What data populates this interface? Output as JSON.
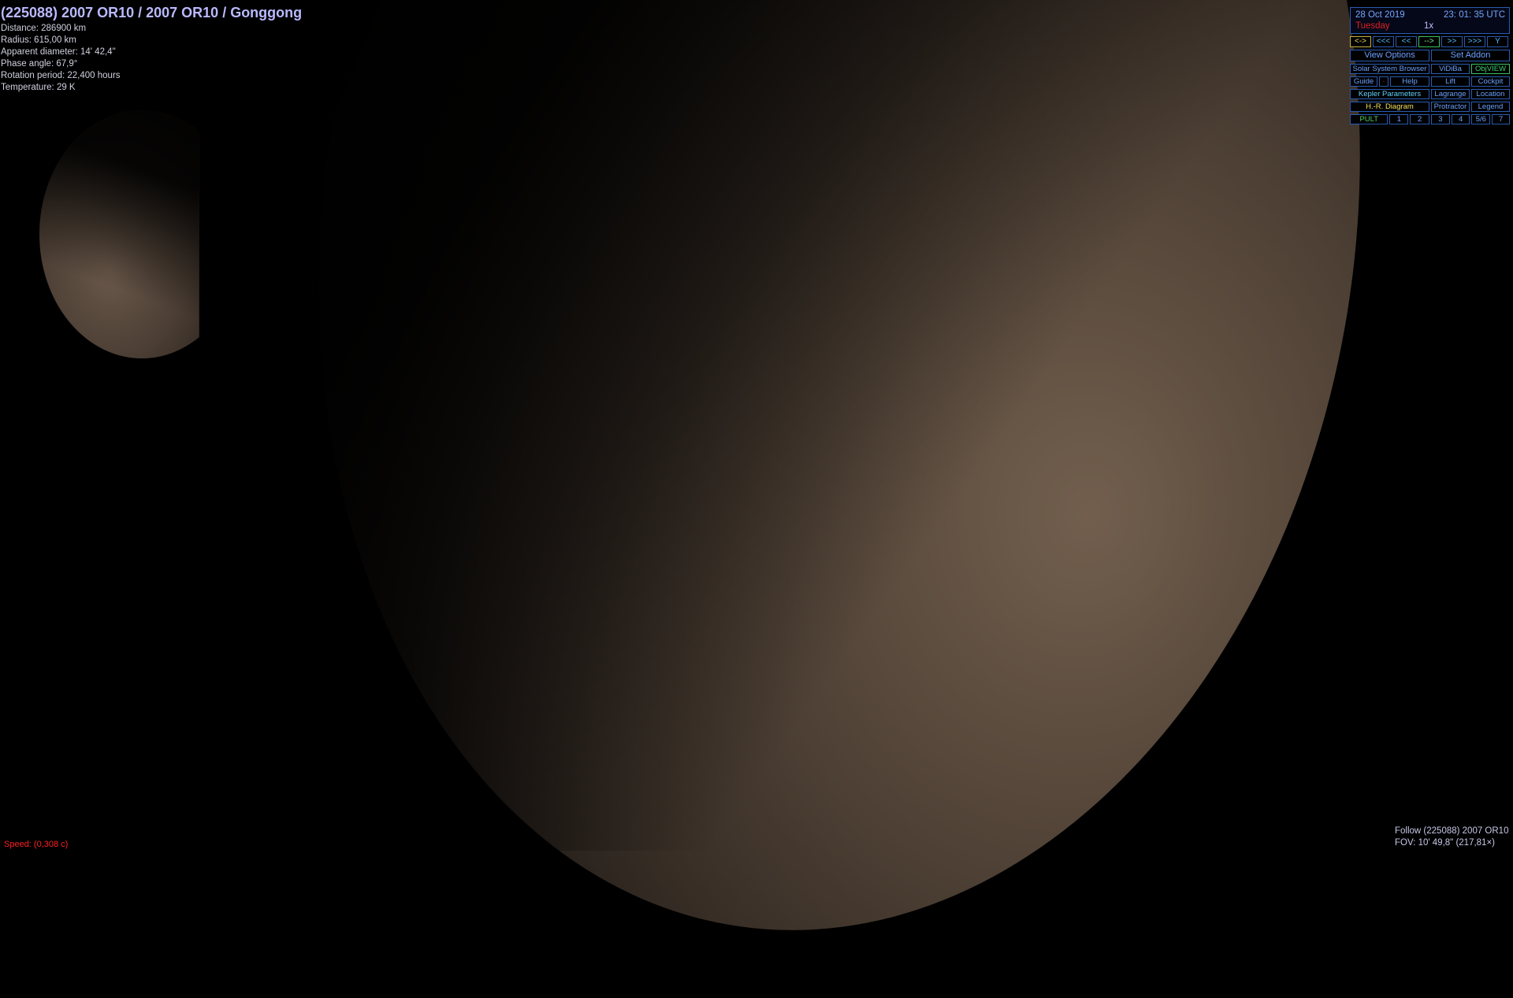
{
  "info": {
    "title": "(225088) 2007 OR10 / 2007 OR10 / Gonggong",
    "lines": [
      "Distance: 286900 km",
      "Radius: 615,00 km",
      "Apparent diameter: 14' 42,4\"",
      "Phase angle: 67,9°",
      "Rotation period: 22,400 hours",
      "Temperature: 29 K"
    ]
  },
  "status": {
    "speed": "Speed: (0,308 c)",
    "follow": "Follow (225088) 2007 OR10",
    "fov": "FOV: 10' 49,8\" (217,81×)"
  },
  "clock": {
    "date": "28 Oct 2019",
    "time": "23: 01: 35 UTC",
    "day": "Tuesday",
    "rate": "1x"
  },
  "nav_buttons": [
    "<->",
    "<<<",
    "<<",
    "-->",
    ">>",
    ">>>",
    "Y"
  ],
  "panel": {
    "view_options": "View Options",
    "set_addon": "Set Addon",
    "solar_system_browser": "Solar System Browser",
    "vidiba": "ViDiBa",
    "objview": "ObjVIEW",
    "guide": "Guide",
    "help": "Help",
    "lift": "Lift",
    "cockpit": "Cockpit",
    "kepler": "Kepler Parameters",
    "lagrange": "Lagrange",
    "location": "Location",
    "hr_diagram": "H.-R. Diagram",
    "protractor": "Protractor",
    "legend": "Legend",
    "pult": "PULT",
    "num": [
      "1",
      "2",
      "3",
      "4",
      "5/6",
      "7"
    ]
  },
  "colors": {
    "panel_border": "#2a5bb0",
    "panel_text": "#6aa0ff",
    "title": "#b9b9ff",
    "speed": "#ff2020"
  }
}
